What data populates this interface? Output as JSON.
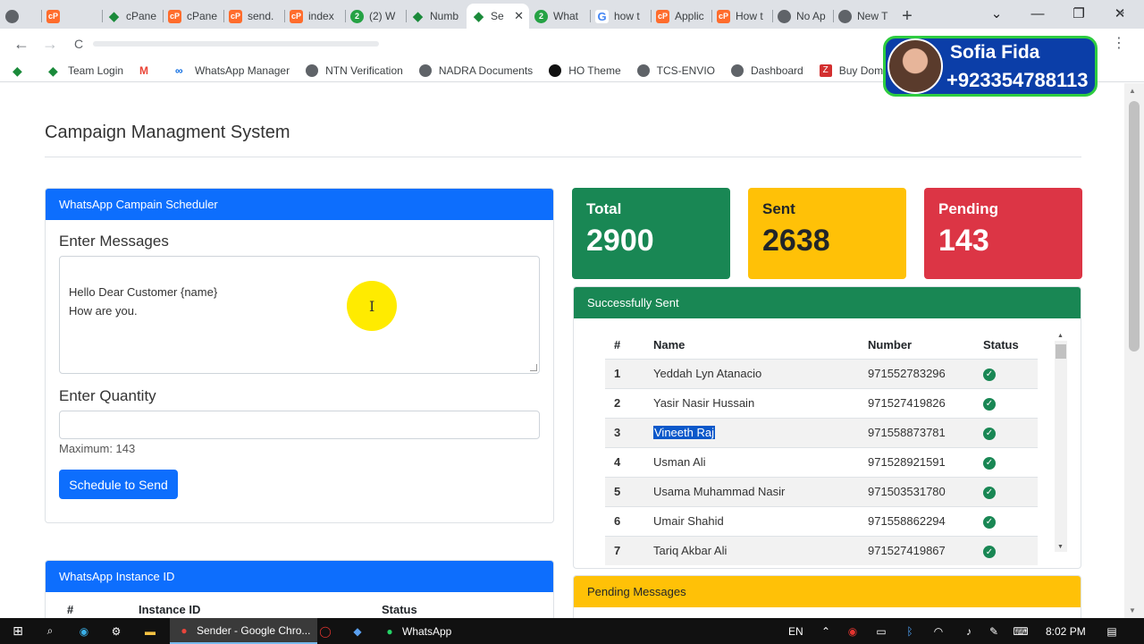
{
  "browser": {
    "tabs": [
      {
        "label": "",
        "icon": "grey"
      },
      {
        "label": "",
        "icon": "cp"
      },
      {
        "label": "cPane",
        "icon": "diamond"
      },
      {
        "label": "cPane",
        "icon": "cp"
      },
      {
        "label": "send.",
        "icon": "cp"
      },
      {
        "label": "index",
        "icon": "cp"
      },
      {
        "label": "(2) W",
        "icon": "green"
      },
      {
        "label": "Numb",
        "icon": "diamond"
      },
      {
        "label": "Se",
        "icon": "diamond",
        "active": true
      },
      {
        "label": "What",
        "icon": "green"
      },
      {
        "label": "how t",
        "icon": "goog"
      },
      {
        "label": "Applic",
        "icon": "cp"
      },
      {
        "label": "How t",
        "icon": "cp"
      },
      {
        "label": "No Ap",
        "icon": "grey"
      },
      {
        "label": "New T",
        "icon": "grey"
      }
    ],
    "tab_close": "✕",
    "new_tab": "+",
    "window": {
      "dropdown": "⌄",
      "minimize": "—",
      "restore": "❐",
      "close": "✕"
    },
    "nav": {
      "back": "←",
      "forward": "→",
      "reload": "C"
    },
    "menu": "⋮",
    "bookmarks": [
      {
        "label": "",
        "icon": "diamond"
      },
      {
        "label": "Team Login",
        "icon": "diamond"
      },
      {
        "label": "",
        "icon": "gm"
      },
      {
        "label": "WhatsApp Manager",
        "icon": "meta"
      },
      {
        "label": "NTN Verification",
        "icon": "grey"
      },
      {
        "label": "NADRA Documents",
        "icon": "grey"
      },
      {
        "label": "HO Theme",
        "icon": "ho"
      },
      {
        "label": "TCS-ENVIO",
        "icon": "grey"
      },
      {
        "label": "Dashboard",
        "icon": "grey"
      },
      {
        "label": "Buy Domai",
        "icon": "z"
      }
    ],
    "bookmarks_more": "»"
  },
  "overlay": {
    "name": "Sofia Fida",
    "phone": "+923354788113"
  },
  "page": {
    "title": "Campaign Managment System",
    "scheduler": {
      "header": "WhatsApp Campain Scheduler",
      "messages_label": "Enter Messages",
      "message_text": "Hello Dear Customer {name}\nHow are you.",
      "quantity_label": "Enter Quantity",
      "quantity_value": "",
      "maximum_hint": "Maximum: 143",
      "submit_label": "Schedule to Send"
    },
    "cursor": "I",
    "stats": {
      "total": {
        "label": "Total",
        "value": "2900"
      },
      "sent": {
        "label": "Sent",
        "value": "2638"
      },
      "pending": {
        "label": "Pending",
        "value": "143"
      }
    },
    "sent_panel": {
      "header": "Successfully Sent",
      "columns": [
        "#",
        "Name",
        "Number",
        "Status"
      ],
      "rows": [
        {
          "n": "1",
          "name": "Yeddah Lyn Atanacio",
          "number": "971552783296"
        },
        {
          "n": "2",
          "name": "Yasir Nasir Hussain",
          "number": "971527419826"
        },
        {
          "n": "3",
          "name": "Vineeth Raj",
          "number": "971558873781",
          "selected": true
        },
        {
          "n": "4",
          "name": "Usman Ali",
          "number": "971528921591"
        },
        {
          "n": "5",
          "name": "Usama Muhammad Nasir",
          "number": "971503531780"
        },
        {
          "n": "6",
          "name": "Umair Shahid",
          "number": "971558862294"
        },
        {
          "n": "7",
          "name": "Tariq Akbar Ali",
          "number": "971527419867"
        }
      ],
      "status_icon": "✓"
    },
    "instance_panel": {
      "header": "WhatsApp Instance ID",
      "columns": [
        "#",
        "Instance ID",
        "Status"
      ]
    },
    "pending_panel": {
      "header": "Pending Messages"
    }
  },
  "taskbar": {
    "apps": [
      {
        "label": "Sender - Google Chro...",
        "active": true
      },
      {
        "label": "WhatsApp",
        "active": false
      }
    ],
    "lang": "EN",
    "time": "8:02 PM"
  },
  "colors": {
    "primary": "#0d6efd",
    "success": "#198754",
    "warning": "#ffc107",
    "danger": "#dc3545"
  }
}
